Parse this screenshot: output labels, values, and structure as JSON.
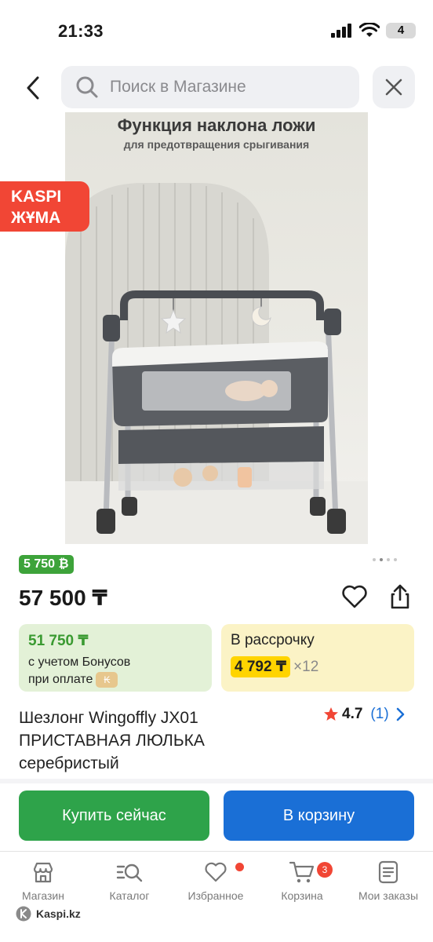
{
  "status": {
    "time": "21:33",
    "battery": "4"
  },
  "search": {
    "placeholder": "Поиск в Магазине"
  },
  "promo": {
    "line1": "KASPI",
    "line2": "ЖҰМА"
  },
  "image": {
    "title": "Функция наклона ложи",
    "subtitle": "для предотвращения срыгивания"
  },
  "product": {
    "bonus_badge": "5 750 ₿",
    "price": "57 500 ₸",
    "bonus_card": {
      "amount": "51 750 ₸",
      "line1": "с учетом Бонусов",
      "line2": "при оплате"
    },
    "installment": {
      "label": "В рассрочку",
      "monthly": "4 792 ₸",
      "multiplier": "×12"
    },
    "title": "Шезлонг Wingoffly JX01 ПРИСТАВНАЯ ЛЮЛЬКА серебристый",
    "rating": "4.7",
    "reviews": "(1)",
    "carousel": {
      "count": 4,
      "active": 2
    }
  },
  "actions": {
    "buy_now": "Купить сейчас",
    "add_to_cart": "В корзину"
  },
  "tabs": [
    {
      "label": "Магазин",
      "icon": "store-icon"
    },
    {
      "label": "Каталог",
      "icon": "catalog-search-icon"
    },
    {
      "label": "Избранное",
      "icon": "heart-icon",
      "dot": true
    },
    {
      "label": "Корзина",
      "icon": "cart-icon",
      "badge": "3"
    },
    {
      "label": "Мои заказы",
      "icon": "orders-icon"
    }
  ],
  "brand": "Kaspi.kz",
  "colors": {
    "green": "#2ea34a",
    "blue": "#1a6fd6",
    "red": "#f14635",
    "yellow": "#ffd400"
  }
}
